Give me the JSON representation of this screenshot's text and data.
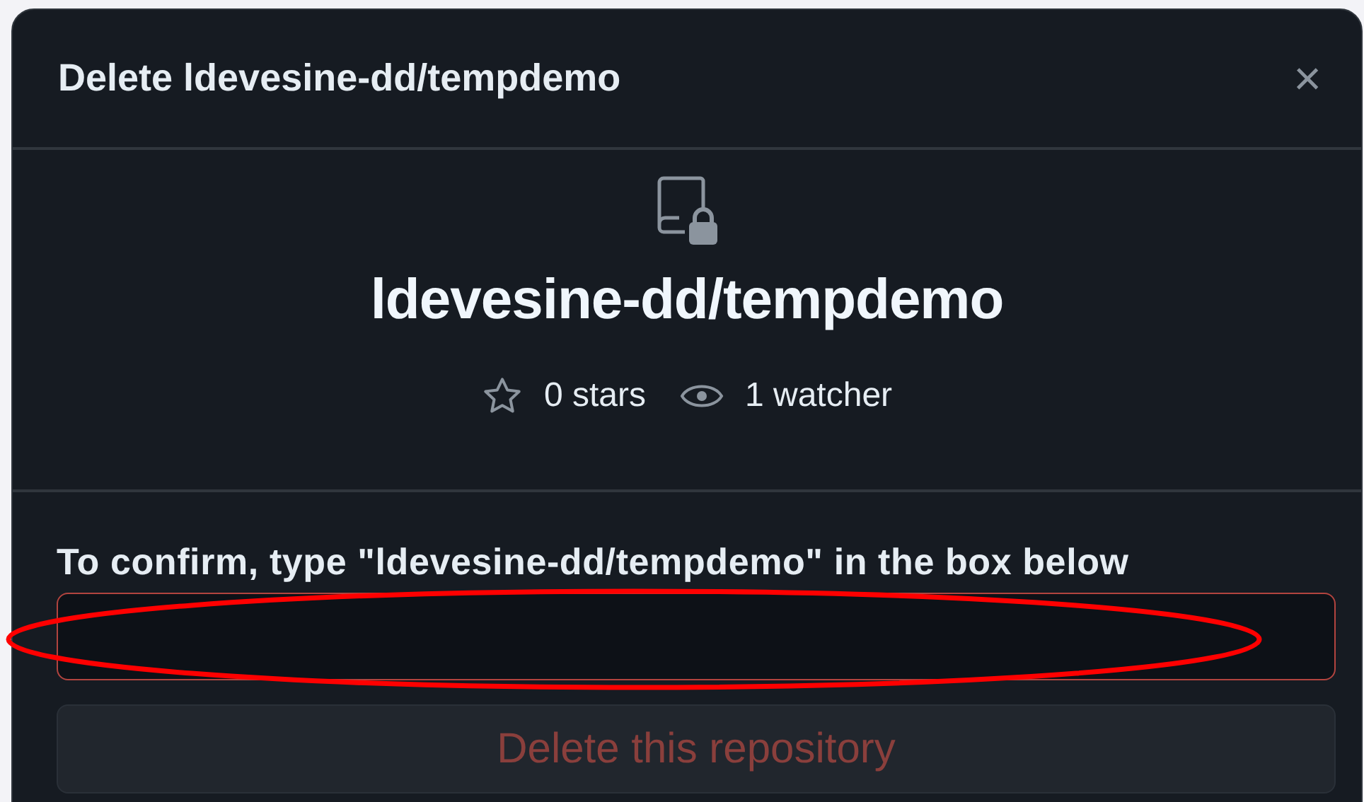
{
  "dialog": {
    "title": "Delete ldevesine-dd/tempdemo",
    "close": "×"
  },
  "repo": {
    "name": "ldevesine-dd/tempdemo",
    "stats": [
      {
        "kind": "stars",
        "text": "0 stars"
      },
      {
        "kind": "watchers",
        "text": "1 watcher"
      }
    ]
  },
  "confirm": {
    "label": "To confirm, type \"ldevesine-dd/tempdemo\" in the box below",
    "invalid": true
  },
  "button": {
    "label": "Delete this repository",
    "disabled": true
  },
  "annotation": {
    "kind": "ellipse",
    "color": "#ff0000"
  }
}
